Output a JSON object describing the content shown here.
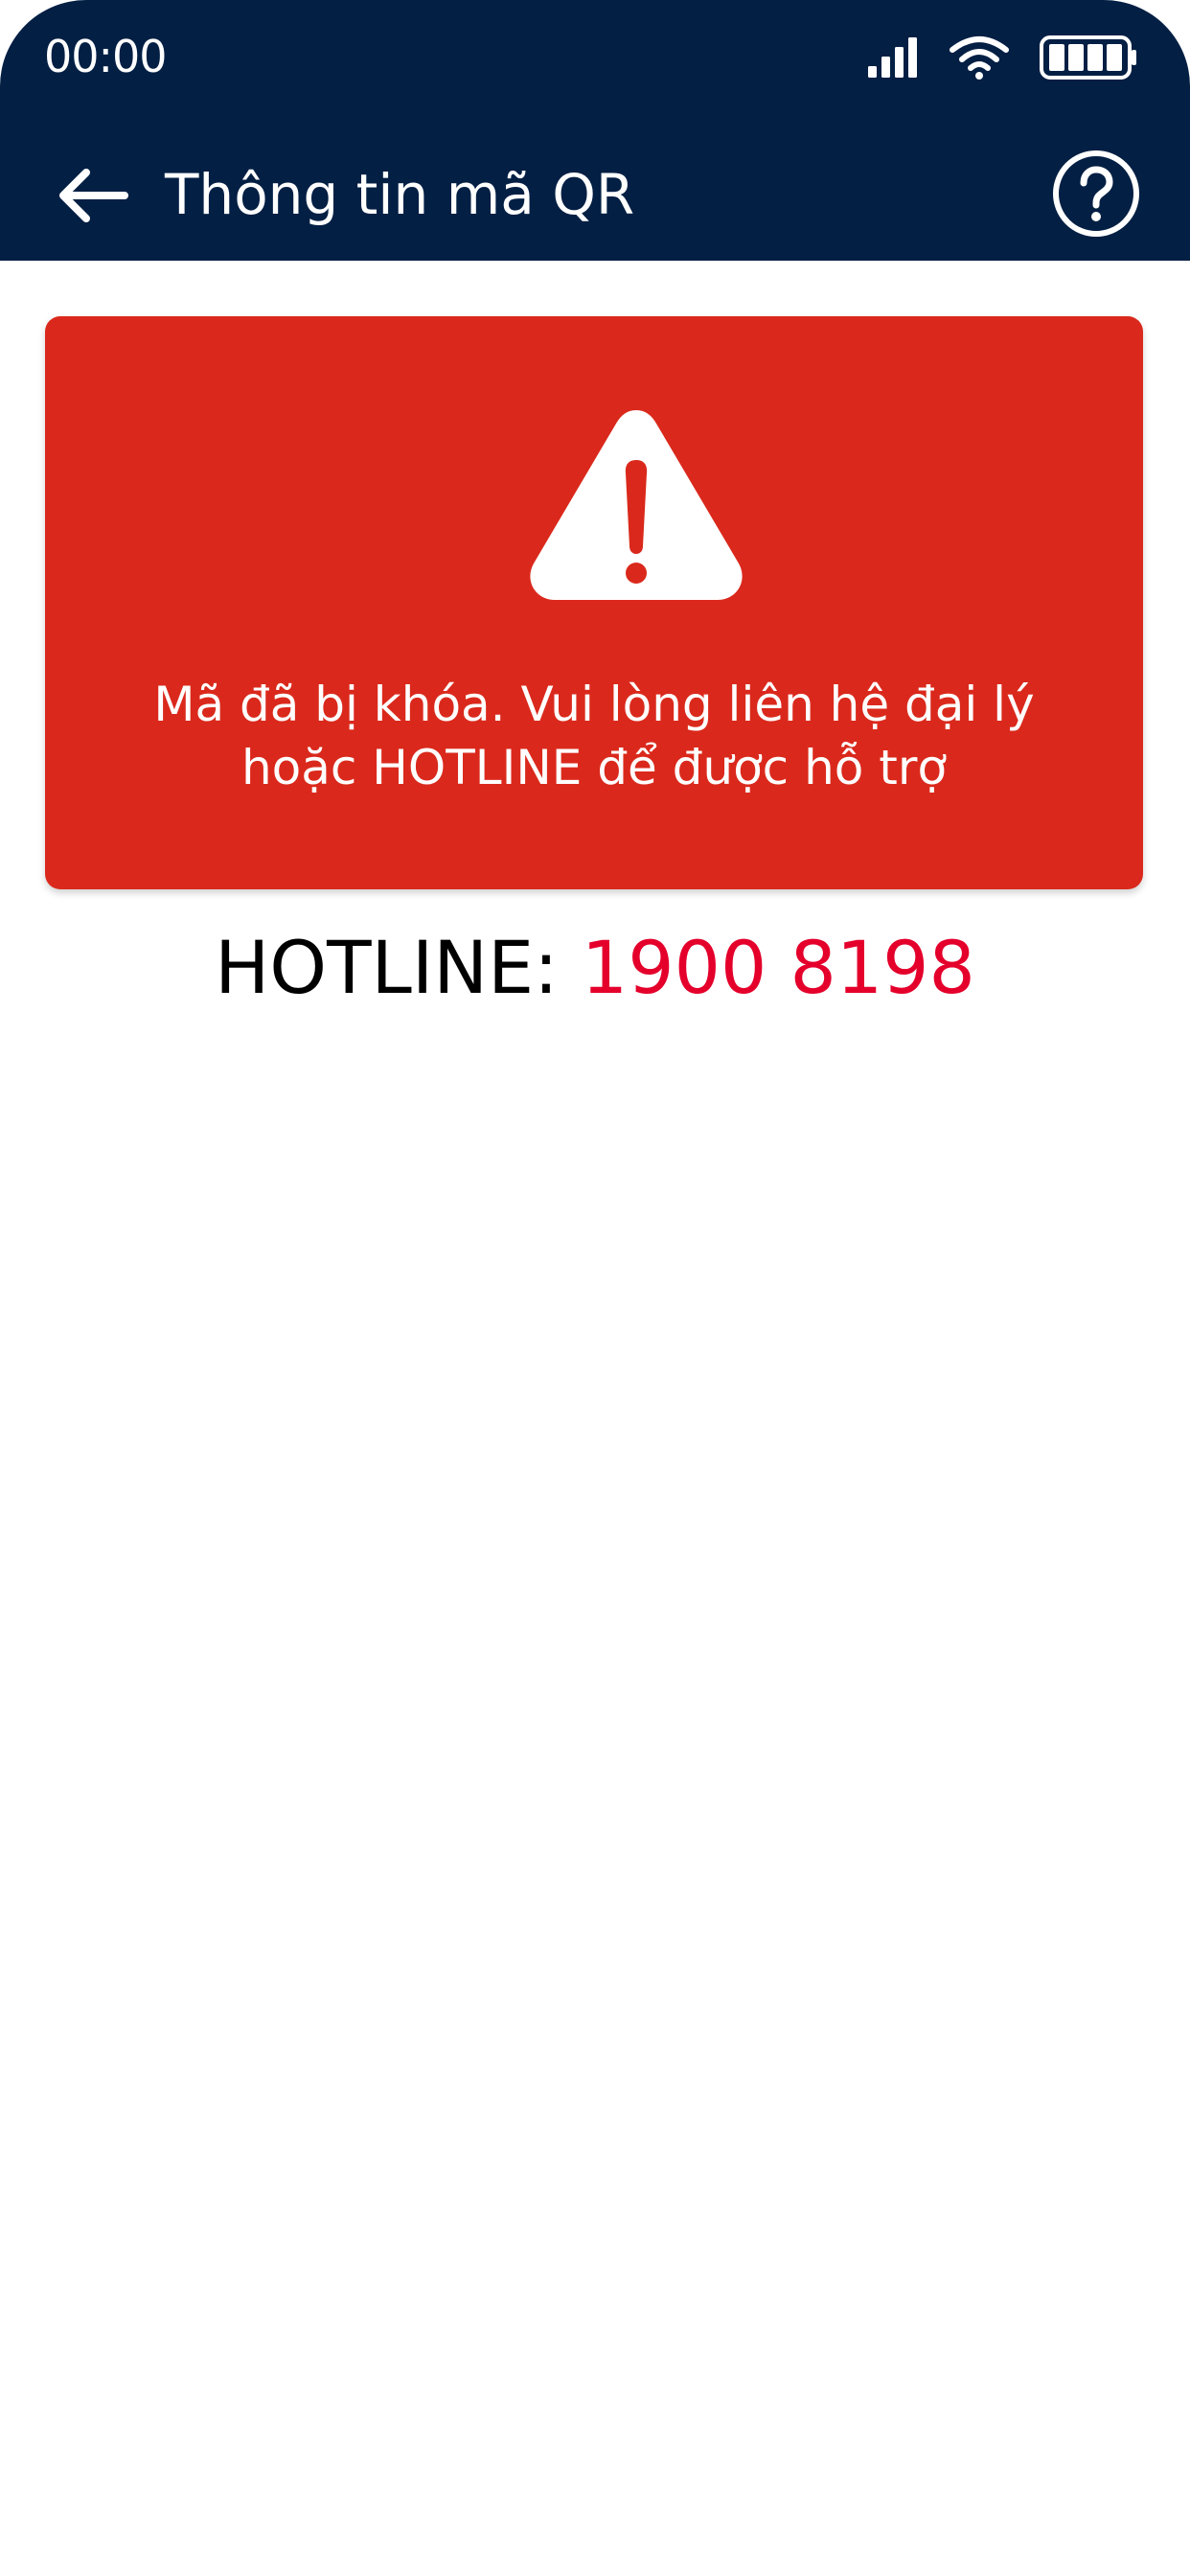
{
  "status_bar": {
    "time": "00:00",
    "icons": [
      "signal-icon",
      "wifi-icon",
      "battery-icon"
    ]
  },
  "header": {
    "title": "Thông tin mã QR",
    "back_icon": "arrow-left-icon",
    "help_icon": "question-circle-icon"
  },
  "alert": {
    "icon": "warning-triangle-icon",
    "message": "Mã đã bị khóa. Vui lòng liên hệ đại lý hoặc HOTLINE để được hỗ trợ"
  },
  "hotline": {
    "label": "HOTLINE:",
    "number": "1900 8198"
  },
  "colors": {
    "header_bg": "#031f44",
    "alert_bg": "#da291c",
    "hotline_number": "#e4002b",
    "text_white": "#ffffff",
    "text_black": "#000000"
  }
}
